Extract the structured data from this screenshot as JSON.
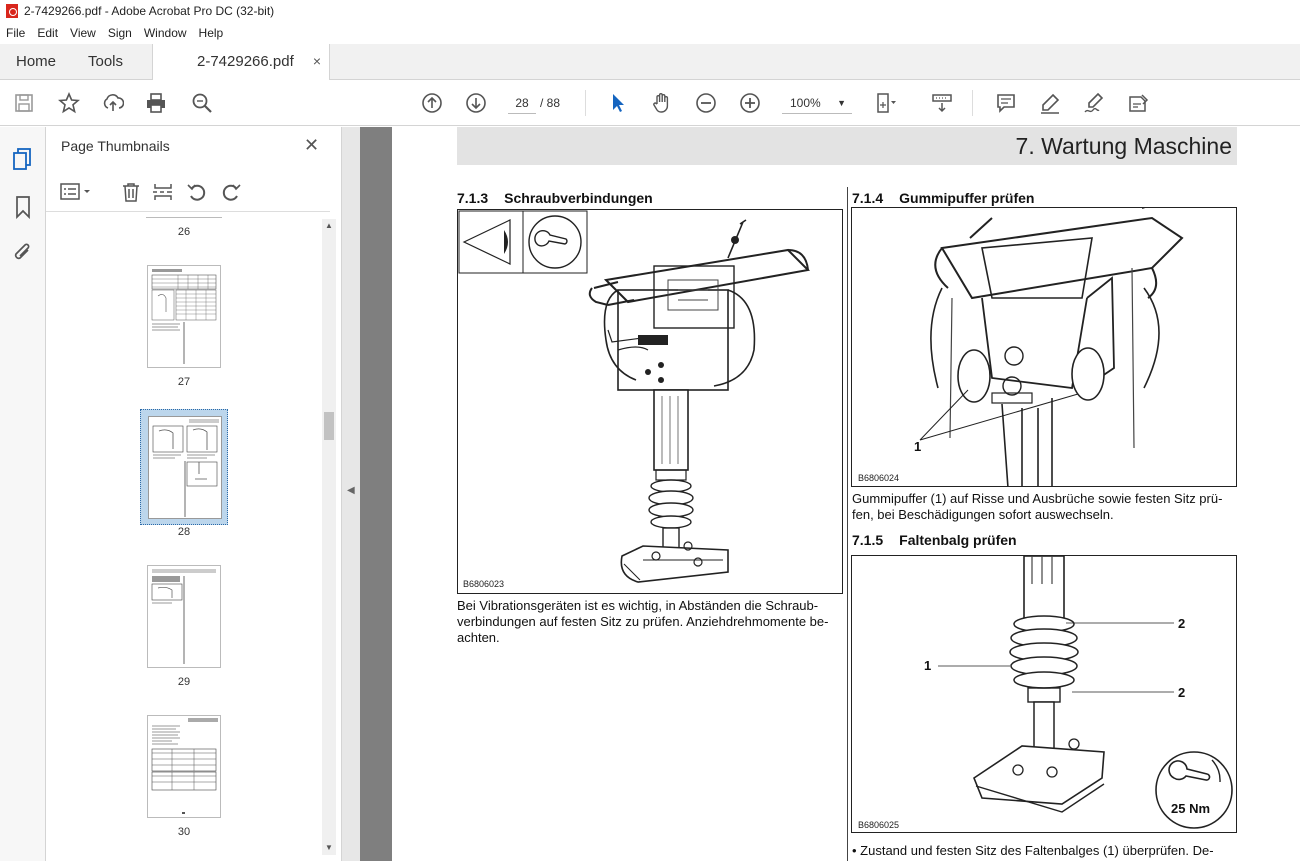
{
  "window": {
    "title": "2-7429266.pdf - Adobe Acrobat Pro DC (32-bit)"
  },
  "menu": {
    "items": [
      "File",
      "Edit",
      "View",
      "Sign",
      "Window",
      "Help"
    ]
  },
  "tabs": {
    "home": "Home",
    "tools": "Tools",
    "document": "2-7429266.pdf",
    "close": "×"
  },
  "toolbar": {
    "current_page": "28",
    "total_pages": "/ 88",
    "zoom": "100%",
    "icons": [
      "save-icon",
      "bookmark-star-icon",
      "upload-icon",
      "print-icon",
      "find-icon",
      "page-up-icon",
      "page-down-icon",
      "select-arrow-icon",
      "hand-icon",
      "zoom-out-icon",
      "zoom-in-icon",
      "fit-page-icon",
      "scroll-mode-icon",
      "comment-icon",
      "highlight-icon",
      "sign-icon",
      "fill-sign-icon"
    ]
  },
  "sidebar": {
    "title": "Page Thumbnails",
    "close": "✕",
    "thumbnails": [
      {
        "label": "26",
        "selected": false
      },
      {
        "label": "27",
        "selected": false
      },
      {
        "label": "28",
        "selected": true
      },
      {
        "label": "29",
        "selected": false
      },
      {
        "label": "30",
        "selected": false
      }
    ]
  },
  "document": {
    "chapter_title": "7. Wartung Maschine",
    "sections": [
      {
        "number": "7.1.3",
        "title": "Schraubverbindungen",
        "figure": "B6806023",
        "text": [
          "Bei Vibrationsgeräten ist es wichtig, in Abständen die Schraub-",
          "verbindungen auf festen Sitz zu prüfen. Anziehdrehmomente be-",
          "achten."
        ]
      },
      {
        "number": "7.1.4",
        "title": "Gummipuffer prüfen",
        "figure": "B6806024",
        "callout": "1",
        "text": [
          "Gummipuffer (1) auf Risse und Ausbrüche sowie festen Sitz prü-",
          "fen, bei Beschädigungen sofort auswechseln."
        ]
      },
      {
        "number": "7.1.5",
        "title": "Faltenbalg prüfen",
        "figure": "B6806025",
        "callouts": [
          "1",
          "2",
          "2"
        ],
        "torque": "25 Nm",
        "text": [
          "•  Zustand und festen Sitz des Faltenbalges (1) überprüfen. De-"
        ]
      }
    ]
  }
}
